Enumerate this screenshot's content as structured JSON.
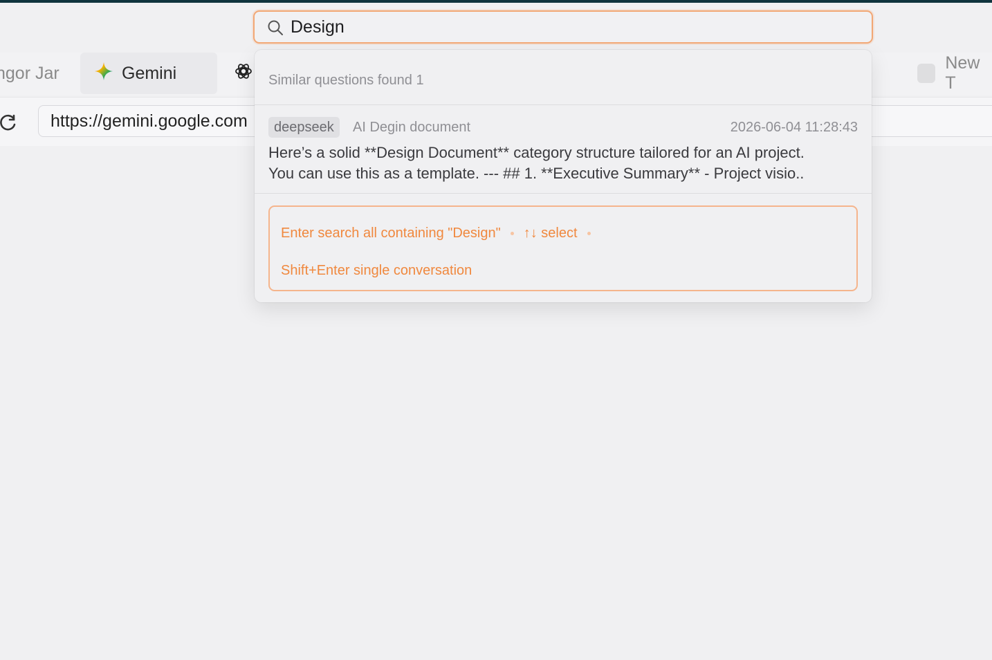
{
  "browser": {
    "tabs": [
      {
        "label": "ngor Jar"
      },
      {
        "label": "Gemini",
        "icon": "gemini-star-icon"
      },
      {
        "label": "",
        "icon": "openai-logo-icon"
      },
      {
        "label": "New T"
      }
    ],
    "address": {
      "url": "https://gemini.google.com"
    }
  },
  "search": {
    "query": "Design",
    "header": "Similar questions found 1",
    "results": [
      {
        "tag": "deepseek",
        "title": "AI Degin document",
        "timestamp": "2026-06-04 11:28:43",
        "snippet_line1": "Here’s a solid **Design Document** category structure tailored for an AI project.",
        "snippet_line2": "You can use this as a template. --- ## 1. **Executive Summary** - Project visio.."
      }
    ],
    "hints": {
      "enter": "Enter search all containing \"Design\"",
      "select": "↑↓ select",
      "shift_enter": "Shift+Enter single conversation"
    }
  },
  "colors": {
    "accent": "#f0883e",
    "accent_border": "#f2a774",
    "top_strip": "#10343e"
  }
}
